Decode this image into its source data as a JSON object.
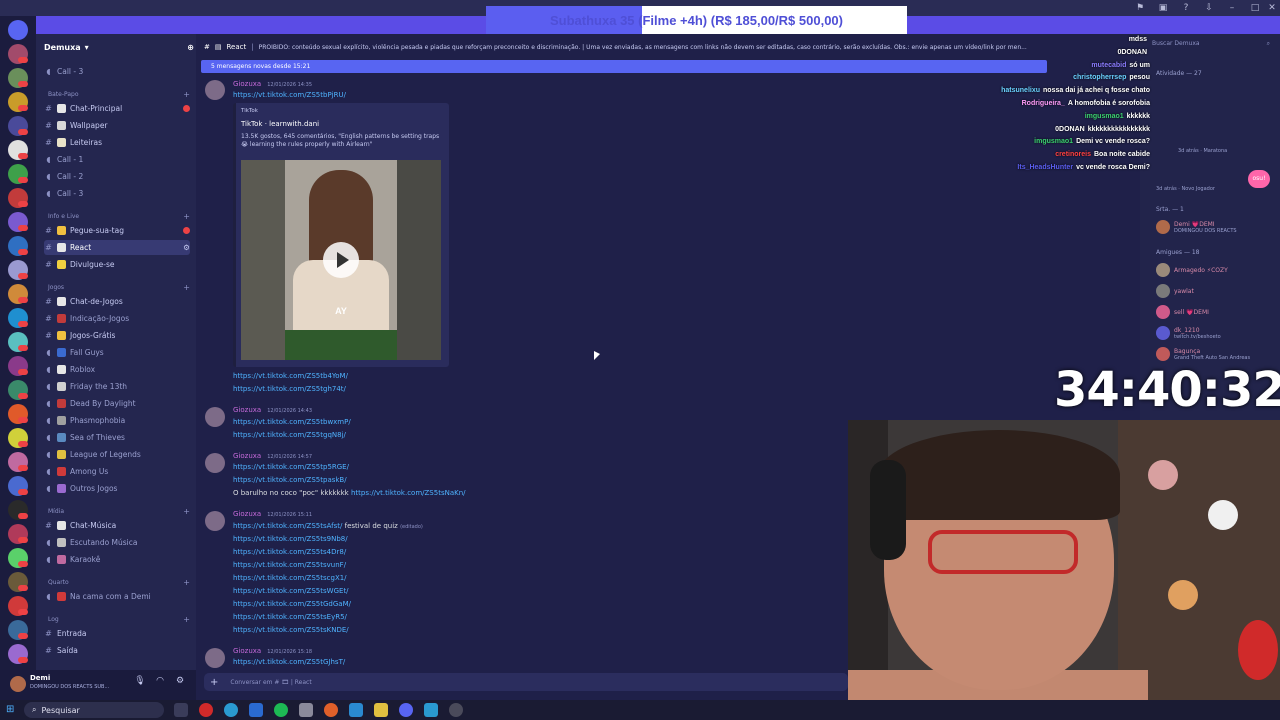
{
  "window": {
    "sub_goal": "Subathuxa 35 (Filme +4h) (R$ 185,00/R$ 500,00)",
    "sub_goal_fraction": 0.37
  },
  "server": {
    "name": "Demuxa"
  },
  "channel_header": {
    "name": "React",
    "topic": "PROIBIDO: conteúdo sexual explícito, violência pesada e piadas que reforçam preconceito e discriminação. | Uma vez enviadas, as mensagens com links não devem ser editadas, caso contrário, serão excluídas. Obs.: envie apenas um vídeo/link por men..."
  },
  "sidebar": {
    "top_voice": "Call - 3",
    "cat_batepapo": "Bate-Papo",
    "ch_chat_principal": "Chat-Principal",
    "ch_wallpaper": "Wallpaper",
    "ch_leiteiras": "Leiteiras",
    "v_call1": "Call - 1",
    "v_call2": "Call - 2",
    "v_call3": "Call - 3",
    "cat_info": "Info e Live",
    "ch_pegue": "Pegue-sua-tag",
    "ch_react": "React",
    "ch_divulgue": "Divulgue-se",
    "cat_jogos": "Jogos",
    "ch_chat_jogos": "Chat-de-Jogos",
    "ch_indicacao": "Indicação-Jogos",
    "ch_jogos_gratis": "Jogos-Grátis",
    "v_fallguys": "Fall Guys",
    "v_roblox": "Roblox",
    "v_friday": "Friday the 13th",
    "v_dbd": "Dead By Daylight",
    "v_phasmo": "Phasmophobia",
    "v_sot": "Sea of Thieves",
    "v_lol": "League of Legends",
    "v_among": "Among Us",
    "v_outros": "Outros Jogos",
    "cat_midia": "Mídia",
    "ch_chat_musica": "Chat-Música",
    "v_escutando": "Escutando Música",
    "v_karaoke": "Karaokê",
    "cat_quarto": "Quarto",
    "v_cama": "Na cama com a Demi",
    "cat_log": "Log",
    "ch_entrada": "Entrada",
    "ch_saida": "Saída"
  },
  "user_panel": {
    "name": "Demi",
    "status": "DOMINGOU DOS REACTS SUB..."
  },
  "new_messages_banner": "5 mensagens novas desde 15:21",
  "messages": [
    {
      "author": "Giozuxa",
      "time": "12/01/2026 14:35",
      "link": "https://vt.tiktok.com/ZS5tbPjRU/"
    },
    {
      "links": [
        "https://vt.tiktok.com/ZS5tb4YoM/",
        "https://vt.tiktok.com/ZS5tgh74t/"
      ]
    },
    {
      "author": "Giozuxa",
      "time": "12/01/2026 14:43",
      "links": [
        "https://vt.tiktok.com/ZS5tbwxmP/",
        "https://vt.tiktok.com/ZS5tgqN8j/"
      ]
    },
    {
      "author": "Giozuxa",
      "time": "12/01/2026 14:57",
      "links": [
        "https://vt.tiktok.com/ZS5tp5RGE/",
        "https://vt.tiktok.com/ZS5tpaskB/"
      ],
      "text_before": "O barulho no coco \"poc\" kkkkkkk ",
      "text_link": "https://vt.tiktok.com/ZS5tsNaKn/"
    },
    {
      "author": "Giozuxa",
      "time": "12/01/2026 15:11",
      "first": "https://vt.tiktok.com/ZS5tsAfst/",
      "first_tail": " festival de quiz",
      "edited": "(editado)",
      "links": [
        "https://vt.tiktok.com/ZS5ts9Nb8/",
        "https://vt.tiktok.com/ZS5ts4Dr8/",
        "https://vt.tiktok.com/ZS5tsvunF/",
        "https://vt.tiktok.com/ZS5tscgX1/",
        "https://vt.tiktok.com/ZS5tsWGEt/",
        "https://vt.tiktok.com/ZS5tGdGaM/",
        "https://vt.tiktok.com/ZS5tsEyR5/",
        "https://vt.tiktok.com/ZS5tsKNDE/"
      ]
    },
    {
      "author": "Giozuxa",
      "time": "12/01/2026 15:18",
      "link": "https://vt.tiktok.com/ZS5tGJhsT/"
    }
  ],
  "embed": {
    "provider": "TikTok",
    "title": "TikTok · learnwith.dani",
    "desc": "13.5K gostos, 645 comentários, \"English patterns be setting traps 😭 learning the rules properly with Airlearn\"",
    "subtitle": "AY"
  },
  "input": {
    "placeholder": "Conversar em # 🎞 | React"
  },
  "taskbar": {
    "search": "Pesquisar"
  },
  "right_panel": {
    "search": "Buscar Demuxa",
    "activity": "Atividade — 27",
    "s_maratona": "3d atrás · Maratona",
    "s_novo": "3d atrás · Novo Jogador",
    "srta": "Srta. — 1",
    "srta_name": "Demi 💗DEMI",
    "srta_sub": "DOMINGOU DOS REACTS",
    "amigues": "Amigues — 18",
    "a1": "Armagedo ⚡COZY",
    "a2": "yawlat",
    "a3": "sell 💗DEMI",
    "a4": "dk_1210",
    "a4s": "twitch.tv/beshoeto",
    "a5": "Bagunça",
    "a5s": "Grand Theft Auto San Andreas"
  },
  "stream_chat": [
    {
      "user": "mdss",
      "msg": "",
      "color": "#ffffff"
    },
    {
      "user": "0DONAN",
      "msg": "",
      "color": "#ffffff"
    },
    {
      "user": "mutecabid",
      "msg": "só um",
      "color": "#8a7cff"
    },
    {
      "user": "christopherrsep",
      "msg": "pesou",
      "color": "#6ad1ff"
    },
    {
      "user": "hatsunelixu",
      "msg": "nossa dai já achei q fosse chato",
      "color": "#6ad1ff"
    },
    {
      "user": "Rodrigueira_",
      "msg": "A homofobia é sorofobia",
      "color": "#ff9cfa"
    },
    {
      "user": "imgusmao1",
      "msg": "kkkkkk",
      "color": "#3bd16f"
    },
    {
      "user": "0DONAN",
      "msg": "kkkkkkkkkkkkkkkk",
      "color": "#ffffff"
    },
    {
      "user": "imgusmao1",
      "msg": "Demi vc vende rosca?",
      "color": "#3bd16f"
    },
    {
      "user": "cretinoreis",
      "msg": "Boa noite cabide",
      "color": "#ff4040"
    },
    {
      "user": "Its_HeadsHunter",
      "msg": "vc vende rosca Demi?",
      "color": "#5b5ef0"
    }
  ],
  "timer": "34:40:32",
  "osu_badge": "osu!"
}
